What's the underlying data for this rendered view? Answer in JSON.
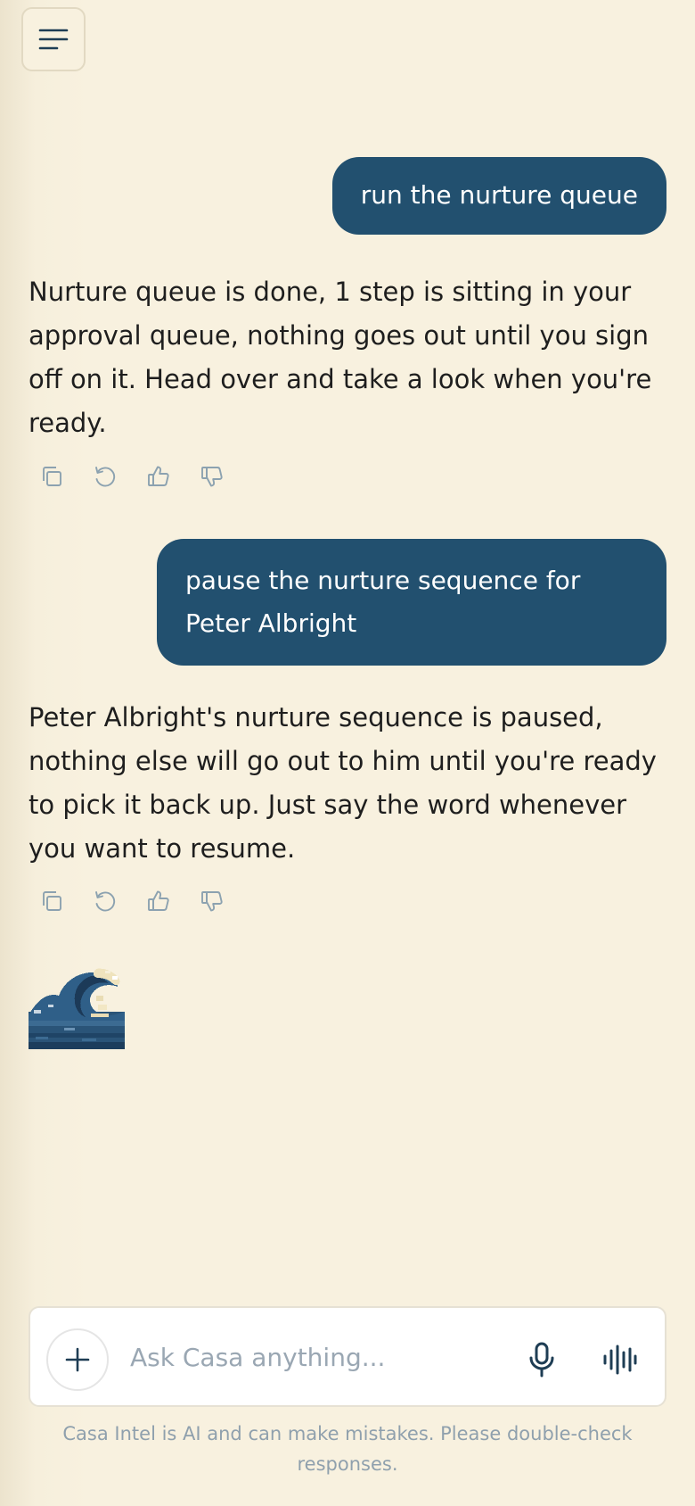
{
  "header": {
    "menu_icon": "hamburger-menu-icon"
  },
  "conversation": {
    "messages": [
      {
        "role": "user",
        "text": "run the nurture queue"
      },
      {
        "role": "assistant",
        "text": "Nurture queue is done, 1 step is sitting in your approval queue, nothing goes out until you sign off on it. Head over and take a look when you're ready."
      },
      {
        "role": "user",
        "text": "pause the nurture sequence for Peter Albright"
      },
      {
        "role": "assistant",
        "text": "Peter Albright's nurture sequence is paused, nothing else will go out to him until you're ready to pick it back up. Just say the word whenever you want to resume."
      }
    ],
    "message_actions": [
      "copy-icon",
      "retry-icon",
      "thumbs-up-icon",
      "thumbs-down-icon"
    ]
  },
  "composer": {
    "placeholder": "Ask Casa anything...",
    "value": "",
    "icons": {
      "attach": "plus-icon",
      "mic": "microphone-icon",
      "voice": "voice-waveform-icon"
    }
  },
  "footer": {
    "disclaimer": "Casa Intel is AI and can make mistakes. Please double-check responses."
  },
  "colors": {
    "background": "#f8f1df",
    "user_bubble": "#22506f",
    "icon_muted": "#8ca2b0",
    "icon_dark": "#1e3d54"
  }
}
